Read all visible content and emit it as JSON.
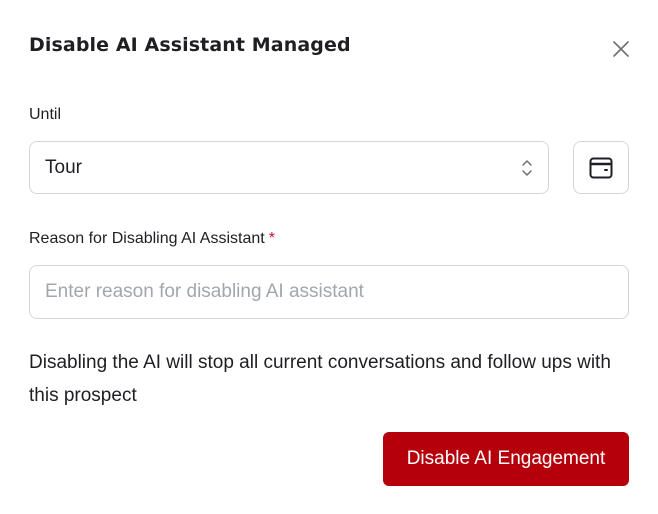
{
  "modal": {
    "title": "Disable AI Assistant Managed",
    "until": {
      "label": "Until",
      "selected": "Tour"
    },
    "reason": {
      "label": "Reason for Disabling AI Assistant",
      "required_mark": "*",
      "value": "",
      "placeholder": "Enter reason for disabling AI assistant"
    },
    "notice": "Disabling the AI will stop all current conversations and follow ups with this prospect",
    "primary_button_label": "Disable AI Engagement",
    "icons": {
      "close": "close-icon",
      "select_arrows": "chevron-up-down-icon",
      "calendar": "calendar-icon"
    },
    "colors": {
      "primary": "#b5000b",
      "required": "#c8102e",
      "border": "#d3d5da",
      "text": "#1f1f23",
      "placeholder": "#a2a6ad"
    }
  }
}
